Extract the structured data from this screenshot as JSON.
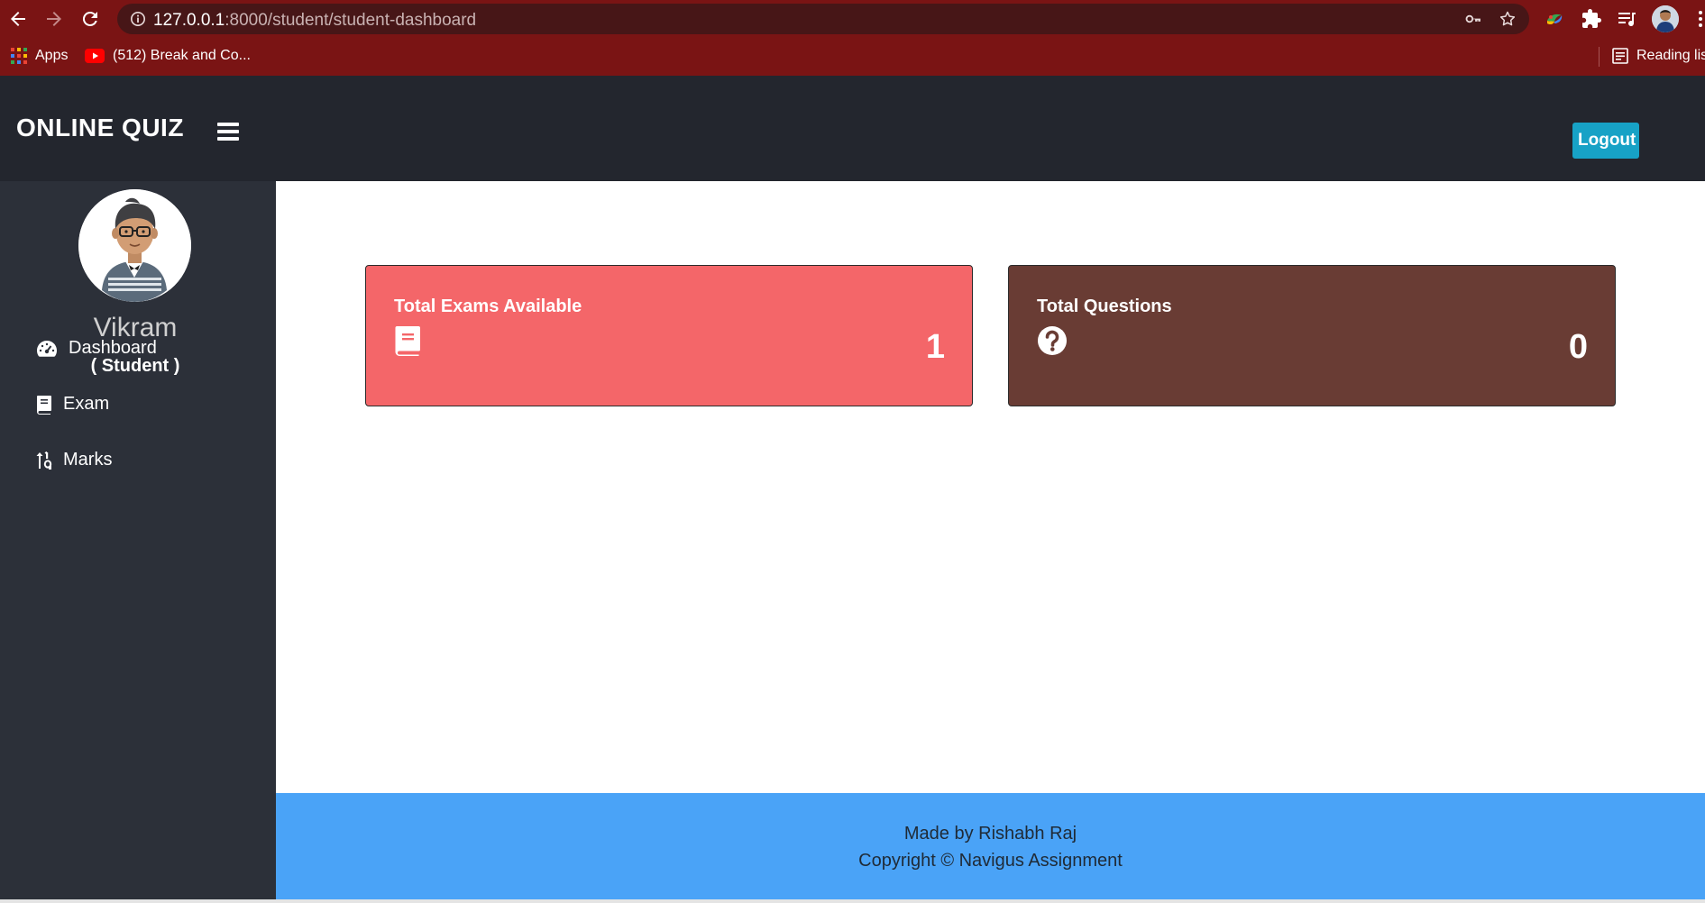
{
  "browser": {
    "url_host": "127.0.0.1",
    "url_rest": ":8000/student/student-dashboard",
    "bookmarks": {
      "apps_label": "Apps",
      "youtube_label": "(512) Break and Co...",
      "reading_list_label": "Reading list"
    },
    "colors": {
      "chrome_bg": "#7a1414",
      "address_bg": "#471617"
    }
  },
  "navbar": {
    "brand": "ONLINE QUIZ",
    "logout_label": "Logout",
    "colors": {
      "bg": "#23262e",
      "logout_bg": "#17a2c6"
    }
  },
  "sidebar": {
    "user_name": "Vikram",
    "user_role": "( Student )",
    "items": [
      {
        "label": "Dashboard",
        "icon": "tachometer-icon"
      },
      {
        "label": "Exam",
        "icon": "book-icon"
      },
      {
        "label": "Marks",
        "icon": "sort-numeric-icon"
      }
    ],
    "colors": {
      "bg": "#2c3039"
    }
  },
  "cards": [
    {
      "title": "Total Exams Available",
      "value": "1",
      "icon": "book-icon",
      "color": "#f46669"
    },
    {
      "title": "Total Questions",
      "value": "0",
      "icon": "question-circle-icon",
      "color": "#693c34"
    }
  ],
  "footer": {
    "line1": "Made by Rishabh Raj",
    "line2": "Copyright © Navigus Assignment",
    "colors": {
      "bg": "#4aa3f7"
    }
  }
}
